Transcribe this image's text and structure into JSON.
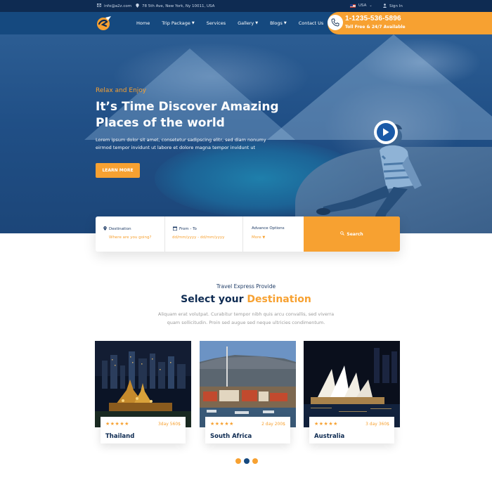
{
  "topbar": {
    "email": "info@a2z.com",
    "address": "78 5th Ave, New York, Ny 10011, USA",
    "language": "USA",
    "signin": "Sign In"
  },
  "nav": {
    "items": [
      {
        "label": "Home",
        "dropdown": false
      },
      {
        "label": "Trip Package",
        "dropdown": true
      },
      {
        "label": "Services",
        "dropdown": false
      },
      {
        "label": "Gallery",
        "dropdown": true
      },
      {
        "label": "Blogs",
        "dropdown": true
      },
      {
        "label": "Contact Us",
        "dropdown": false
      }
    ]
  },
  "call": {
    "number": "1-1235-536-5896",
    "subtitle": "Toll Free & 24/7 Available"
  },
  "hero": {
    "kicker": "Relax and Enjoy",
    "title": "It’s Time Discover Amazing Places of the world",
    "description": "Lorem ipsum dolor sit amet, consetetur sadipscing elitr, sed diam nonumy eirmod tempor invidunt ut labore et dolore magna tempor invidunt ut",
    "button": "LEARN MORE"
  },
  "search": {
    "destination_label": "Destination",
    "destination_placeholder": "Where are you going?",
    "date_label": "From - To",
    "date_placeholder": "dd/mm/yyyy - dd/mm/yyyy",
    "advanced_label": "Advance Options",
    "more_label": "More",
    "button": "Search"
  },
  "section": {
    "kicker": "Travel Express Provide",
    "title_main": "Select your",
    "title_accent": "Destination",
    "description": "Aliquam erat volutpat. Curabitur tempor nibh quis arcu convallis, sed viverra quam sollicitudin. Proin sed augue sed neque ultricies condimentum."
  },
  "cards": [
    {
      "name": "Thailand",
      "price": "3day 560$",
      "rating": 5
    },
    {
      "name": "South Africa",
      "price": "2 day 200$",
      "rating": 5
    },
    {
      "name": "Australia",
      "price": "3 day 360$",
      "rating": 5
    }
  ],
  "carousel": {
    "total": 3,
    "active": 1
  },
  "colors": {
    "accent": "#f7a131",
    "primary": "#15497f",
    "dark": "#0e2b52"
  }
}
